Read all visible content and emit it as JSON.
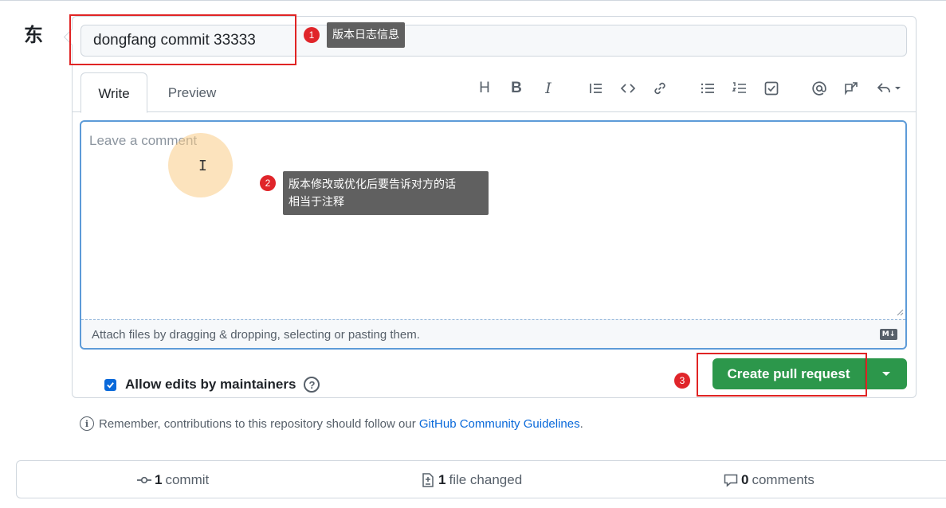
{
  "avatar": {
    "glyph": "东"
  },
  "title_input": {
    "value": "dongfang commit 33333"
  },
  "tabs": [
    {
      "label": "Write"
    },
    {
      "label": "Preview"
    }
  ],
  "toolbar": {
    "heading": "H",
    "bold": "B",
    "italic": "I"
  },
  "editor": {
    "placeholder": "Leave a comment",
    "attach_hint": "Attach files by dragging & dropping, selecting or pasting them.",
    "markdown_badge": "M↓"
  },
  "annotations": [
    {
      "number": "1",
      "text": "版本日志信息"
    },
    {
      "number": "2",
      "line1": "版本修改或优化后要告诉对方的话",
      "line2": "相当于注释"
    },
    {
      "number": "3"
    }
  ],
  "allow_edits": {
    "label": "Allow edits by maintainers",
    "checked": true,
    "help": "?"
  },
  "actions": {
    "create_label": "Create pull request"
  },
  "guidelines": {
    "prefix": "Remember, contributions to this repository should follow our ",
    "link": "GitHub Community Guidelines",
    "suffix": "."
  },
  "stats": {
    "commits": {
      "count": "1",
      "label": "commit"
    },
    "files": {
      "count": "1",
      "label": "file changed"
    },
    "comments": {
      "count": "0",
      "label": "comments"
    }
  },
  "colors": {
    "primary_button": "#2c974b",
    "link": "#0969da",
    "annotation_red": "#e0252a",
    "focus_border": "#5d9bd8"
  }
}
